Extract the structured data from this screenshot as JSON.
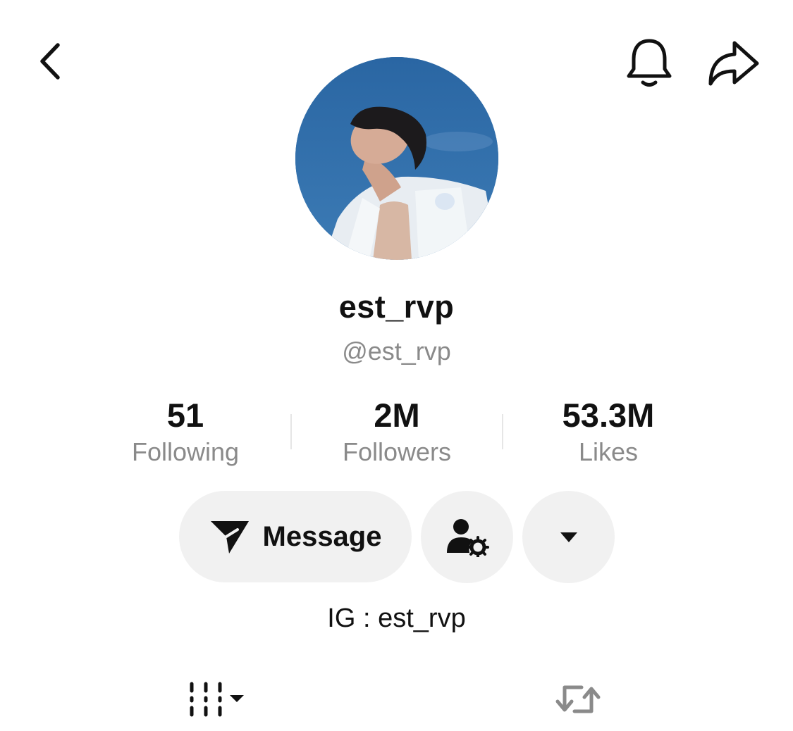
{
  "header": {
    "back_icon": "chevron-left-icon",
    "notification_icon": "bell-icon",
    "share_icon": "share-arrow-icon"
  },
  "profile": {
    "display_name": "est_rvp",
    "handle": "@est_rvp",
    "avatar": "profile-photo"
  },
  "stats": [
    {
      "value": "51",
      "label": "Following"
    },
    {
      "value": "2M",
      "label": "Followers"
    },
    {
      "value": "53.3M",
      "label": "Likes"
    }
  ],
  "actions": {
    "message_label": "Message",
    "message_icon": "send-icon",
    "friend_settings_icon": "person-gear-icon",
    "more_icon": "caret-down-icon"
  },
  "bio": "IG : est_rvp",
  "tabs": {
    "videos_icon": "grid-lines-icon",
    "reposts_icon": "repost-icon"
  },
  "colors": {
    "background": "#ffffff",
    "primary_text": "#111111",
    "secondary_text": "#8a8a8a",
    "button_bg": "#f1f1f1",
    "avatar_sky": "#2c69a4"
  }
}
